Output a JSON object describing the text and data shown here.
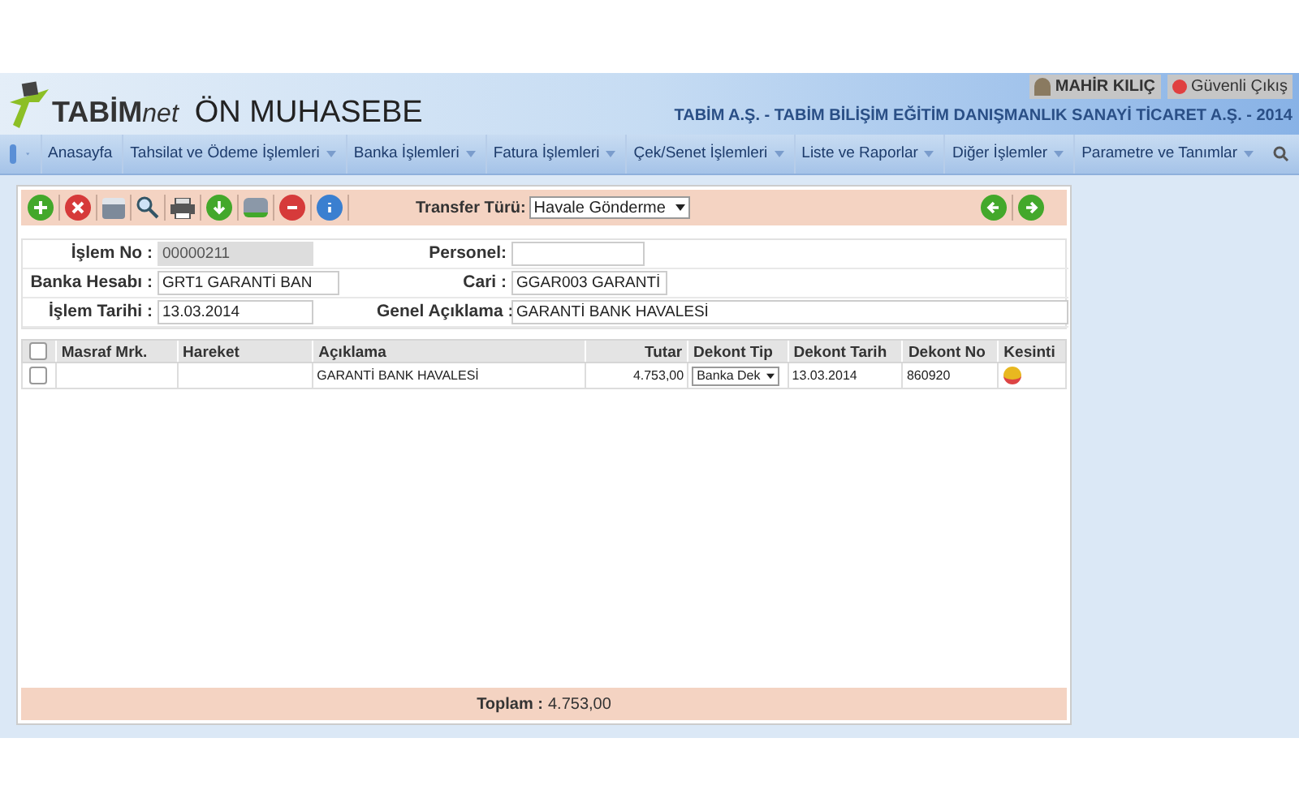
{
  "header": {
    "brand": "TABİM",
    "brand_suffix": "net",
    "app_title": "ÖN MUHASEBE",
    "user": "MAHİR KILIÇ",
    "logout": "Güvenli Çıkış",
    "company": "TABİM A.Ş. - TABİM BİLİŞİM EĞİTİM DANIŞMANLIK SANAYİ TİCARET A.Ş. - 2014"
  },
  "menu": [
    "Anasayfa",
    "Tahsilat ve Ödeme İşlemleri",
    "Banka İşlemleri",
    "Fatura İşlemleri",
    "Çek/Senet İşlemleri",
    "Liste ve Raporlar",
    "Diğer İşlemler",
    "Parametre ve Tanımlar"
  ],
  "menu_dropdown": [
    false,
    true,
    true,
    true,
    true,
    true,
    true,
    true
  ],
  "toolbar": {
    "transfer_label": "Transfer Türü:",
    "transfer_value": "Havale Gönderme"
  },
  "fields": [
    {
      "label": "İşlem No :",
      "value": "00000211",
      "disabled": true
    },
    {
      "label": "Personel:",
      "disabled": false
    },
    {
      "label": "Banka Hesabı :",
      "value": "GRT1 GARANTİ BAN",
      "disabled": false
    },
    {
      "label": "Cari :",
      "value": "GGAR003 GARANTİ",
      "disabled": false
    },
    {
      "label": "İşlem Tarihi :",
      "value": "13.03.2014",
      "disabled": false
    },
    {
      "label": "Genel Açıklama :",
      "value": "GARANTİ BANK HAVALESİ",
      "disabled": false
    }
  ],
  "table": {
    "header_checked": false,
    "columns": [
      "Masraf Mrk.",
      "Hareket",
      "Açıklama",
      "Tutar",
      "Dekont Tip",
      "Dekont Tarih",
      "Dekont No",
      "Kesinti"
    ],
    "rows": [
      {
        "checked": false,
        "cells": [
          "",
          "",
          "GARANTİ BANK HAVALESİ",
          "4.753,00",
          "Banka Dek",
          "13.03.2014",
          "860920"
        ]
      }
    ]
  },
  "total": {
    "label": "Toplam :",
    "value": "4.753,00"
  }
}
